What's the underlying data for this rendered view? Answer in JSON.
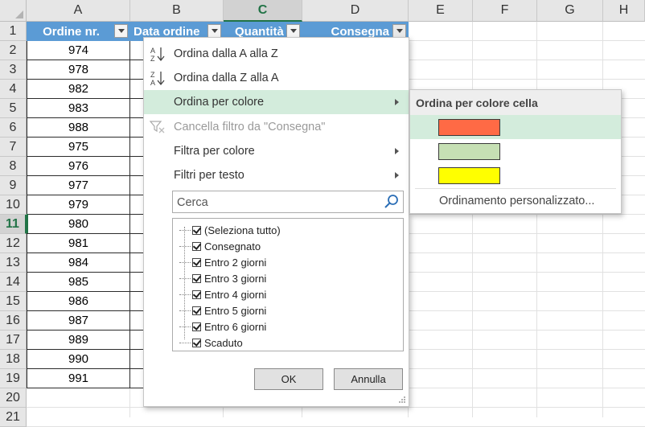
{
  "spreadsheet": {
    "columns": [
      "A",
      "B",
      "C",
      "D",
      "E",
      "F",
      "G",
      "H"
    ],
    "selected_column": "C",
    "rows": [
      "1",
      "2",
      "3",
      "4",
      "5",
      "6",
      "7",
      "8",
      "9",
      "10",
      "11",
      "12",
      "13",
      "14",
      "15",
      "16",
      "17",
      "18",
      "19",
      "20",
      "21"
    ],
    "selected_row": "11",
    "table_headers": [
      "Ordine nr.",
      "Data ordine",
      "Quantità",
      "Consegna"
    ],
    "order_numbers": [
      "974",
      "978",
      "982",
      "983",
      "988",
      "975",
      "976",
      "977",
      "979",
      "980",
      "981",
      "984",
      "985",
      "986",
      "987",
      "989",
      "990",
      "991"
    ]
  },
  "filter_menu": {
    "sort_az": "Ordina dalla A alla Z",
    "sort_za": "Ordina dalla Z alla A",
    "sort_by_color": "Ordina per colore",
    "clear_filter": "Cancella filtro da \"Consegna\"",
    "filter_by_color": "Filtra per colore",
    "text_filters": "Filtri per testo",
    "search_placeholder": "Cerca",
    "items": [
      "(Seleziona tutto)",
      "Consegnato",
      "Entro 2 giorni",
      "Entro 3 giorni",
      "Entro 4 giorni",
      "Entro 5 giorni",
      "Entro 6 giorni",
      "Scaduto"
    ],
    "ok_label": "OK",
    "cancel_label": "Annulla"
  },
  "color_submenu": {
    "title": "Ordina per colore cella",
    "colors": [
      "#ff6a45",
      "#c6e0b4",
      "#ffff00"
    ],
    "custom_sort": "Ordinamento personalizzato..."
  },
  "colors": {
    "table_header": "#5b9bd5",
    "highlight": "#d3ecdc",
    "excel_green": "#217346"
  }
}
